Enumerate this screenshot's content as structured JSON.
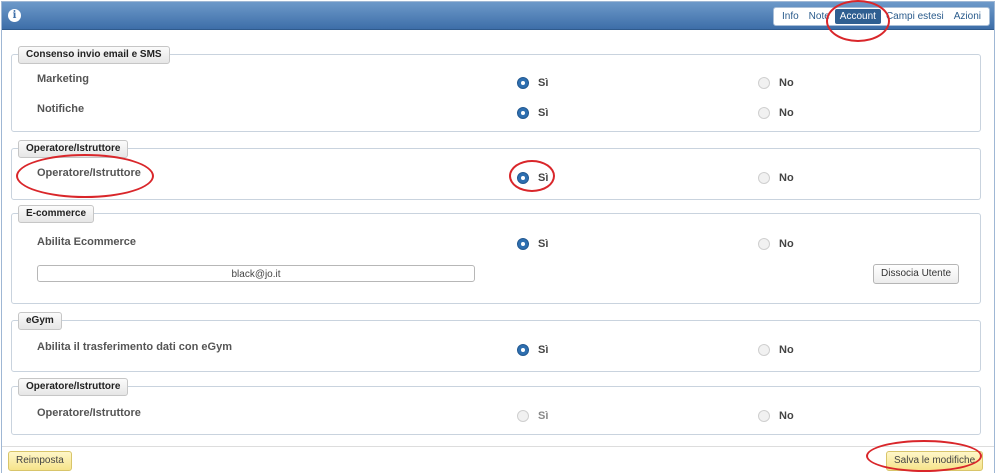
{
  "titlebar": {
    "info_icon": "i",
    "tabs": [
      {
        "label": "Info",
        "active": false
      },
      {
        "label": "Note",
        "active": false
      },
      {
        "label": "Account",
        "active": true
      },
      {
        "label": "Campi estesi",
        "active": false
      },
      {
        "label": "Azioni",
        "active": false
      }
    ]
  },
  "sections": {
    "consent": {
      "legend": "Consenso invio email e SMS",
      "rows": [
        {
          "label": "Marketing",
          "yes": "Sì",
          "no": "No",
          "value": "yes"
        },
        {
          "label": "Notifiche",
          "yes": "Sì",
          "no": "No",
          "value": "yes"
        }
      ]
    },
    "operator1": {
      "legend": "Operatore/Istruttore",
      "rows": [
        {
          "label": "Operatore/Istruttore",
          "yes": "Sì",
          "no": "No",
          "value": "yes"
        }
      ]
    },
    "ecommerce": {
      "legend": "E-commerce",
      "rows": [
        {
          "label": "Abilita Ecommerce",
          "yes": "Sì",
          "no": "No",
          "value": "yes"
        }
      ],
      "email_value": "black@jo.it",
      "dissocia_label": "Dissocia Utente"
    },
    "egym": {
      "legend": "eGym",
      "rows": [
        {
          "label": "Abilita il trasferimento dati con eGym",
          "yes": "Sì",
          "no": "No",
          "value": "yes"
        }
      ]
    },
    "operator2": {
      "legend": "Operatore/Istruttore",
      "rows": [
        {
          "label": "Operatore/Istruttore",
          "yes": "Sì",
          "no": "No",
          "value": "none"
        }
      ]
    }
  },
  "footer": {
    "reset_label": "Reimposta",
    "save_label": "Salva le modifiche"
  },
  "colors": {
    "titlebar": "#3d6ea8",
    "radio_on": "#2e6fb0",
    "annotation": "#d9262a",
    "footer_button": "#f6e38a"
  }
}
